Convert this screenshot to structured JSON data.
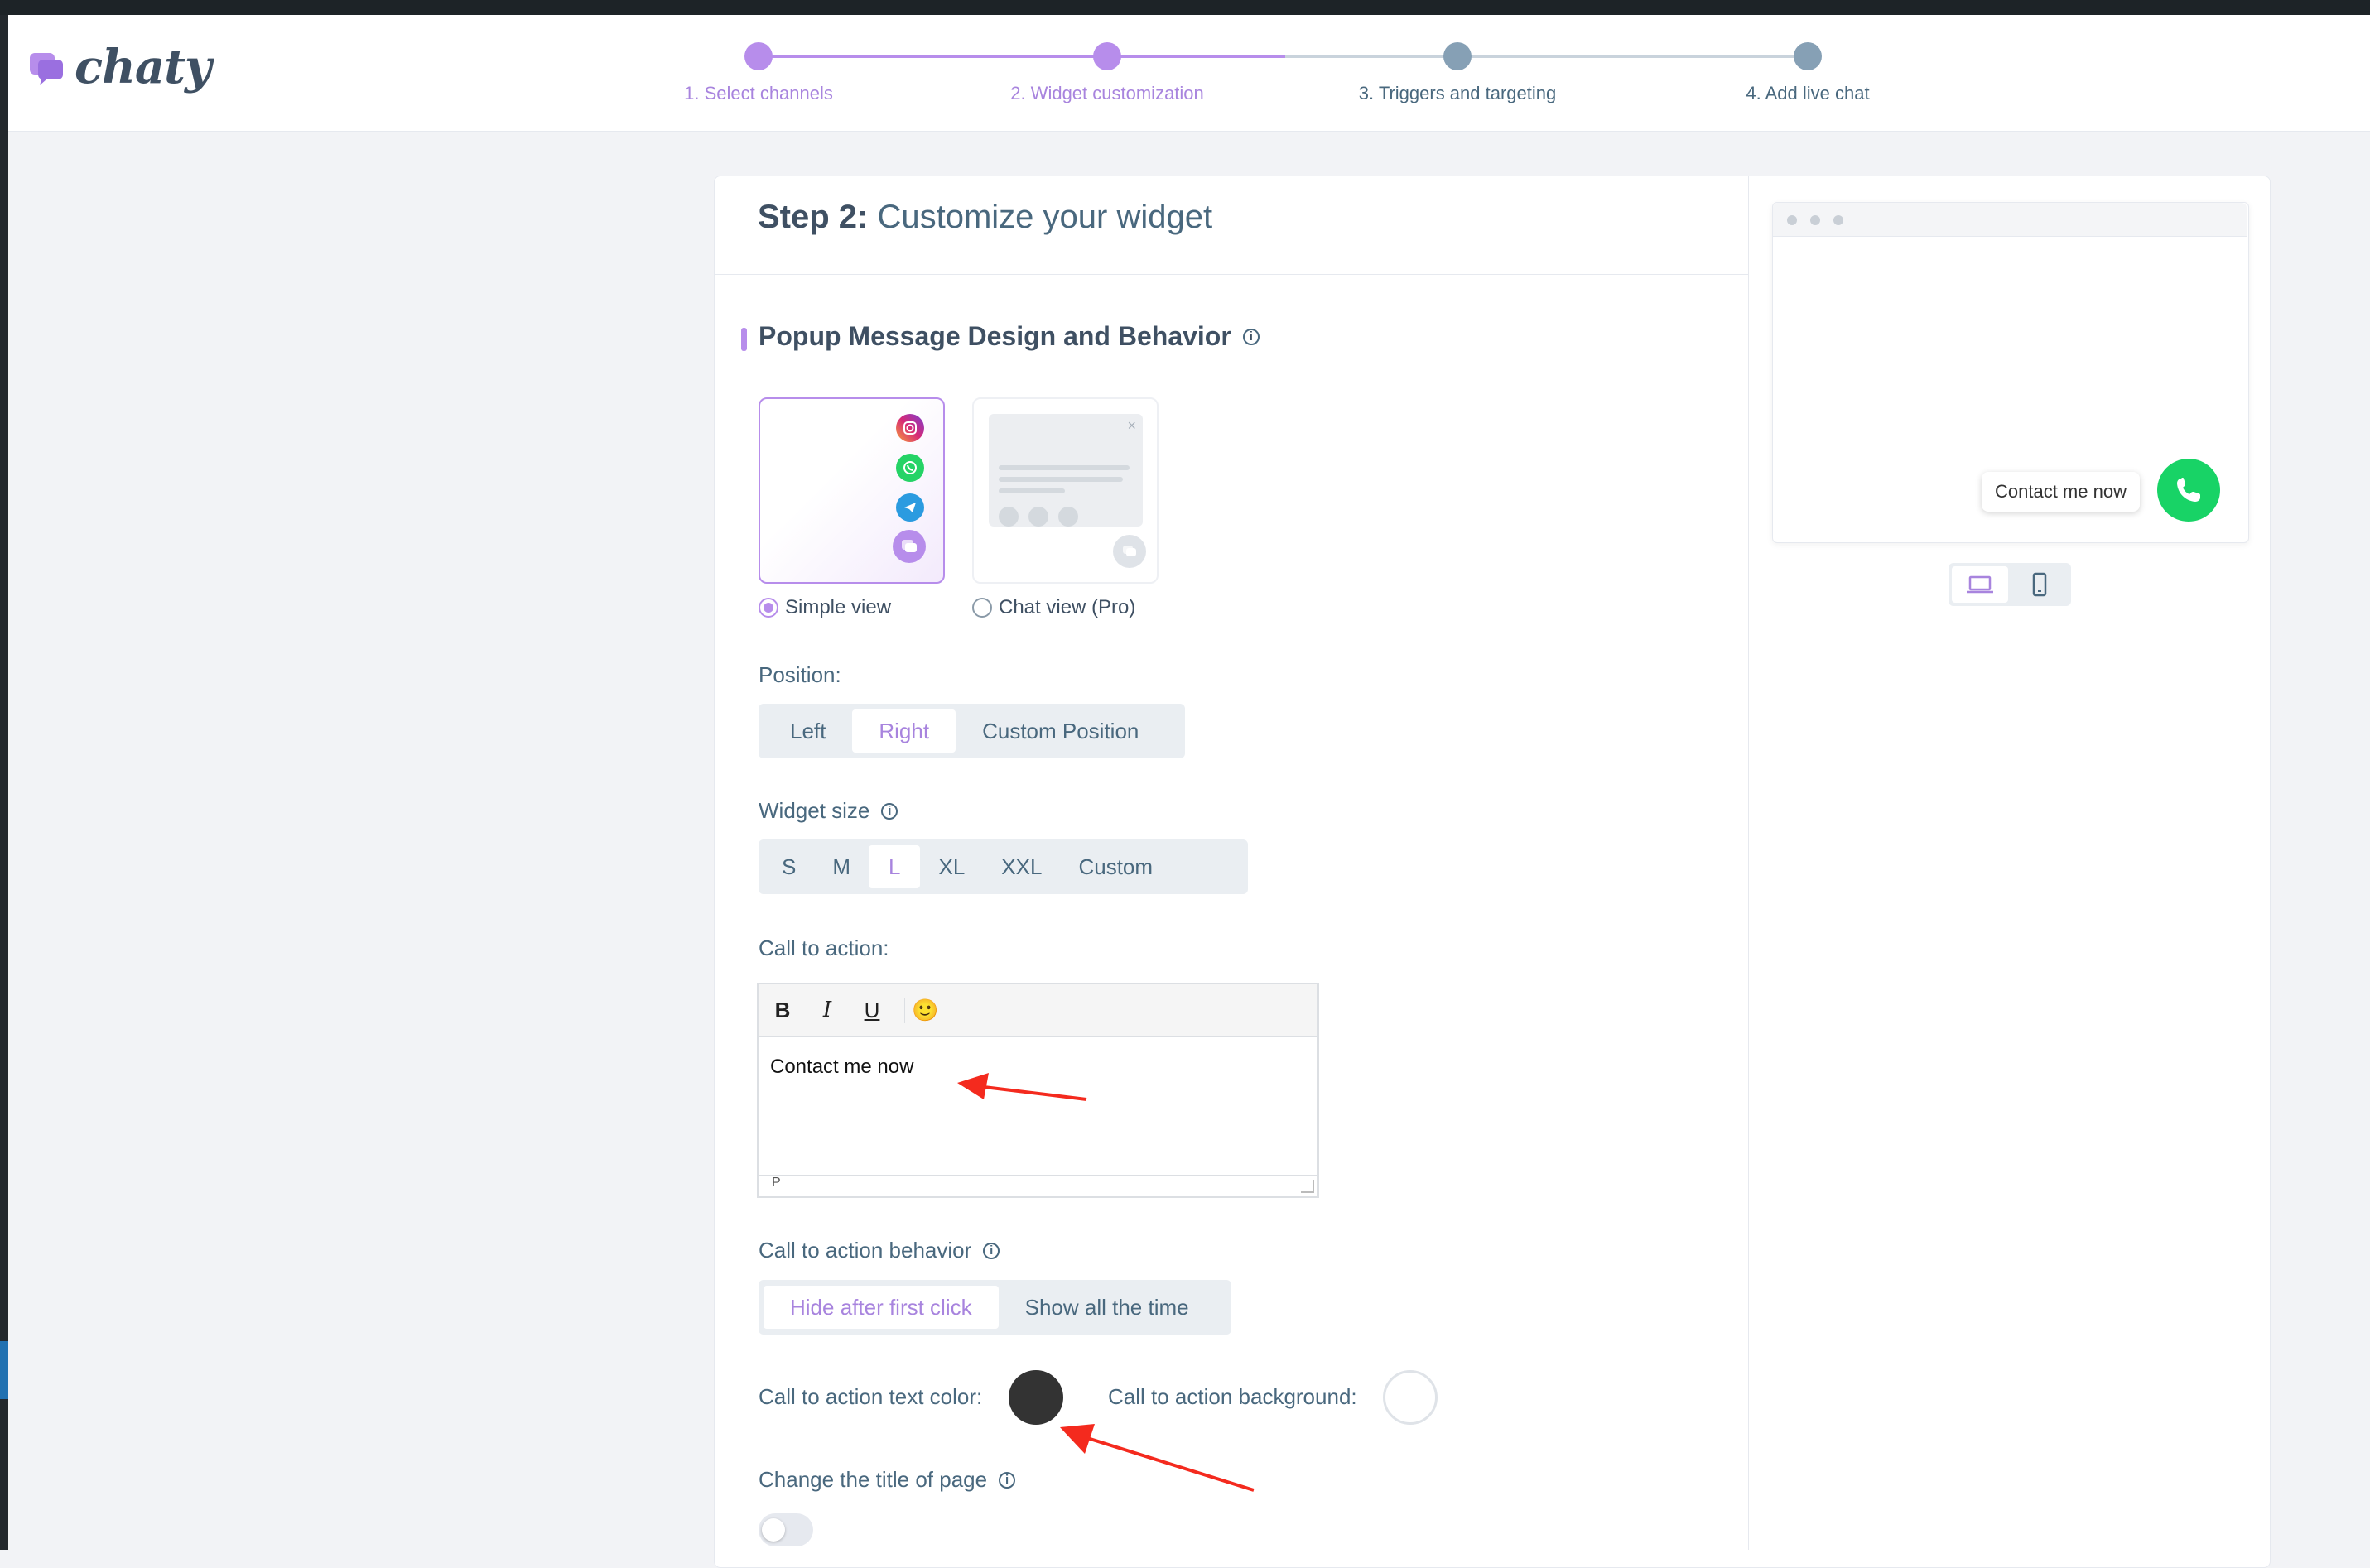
{
  "app": {
    "logo_text": "chaty",
    "brand_color": "#b78deb"
  },
  "stepper": {
    "steps": [
      {
        "label": "1. Select channels",
        "state": "done"
      },
      {
        "label": "2. Widget customization",
        "state": "active"
      },
      {
        "label": "3. Triggers and targeting",
        "state": "pending"
      },
      {
        "label": "4. Add live chat",
        "state": "pending"
      }
    ]
  },
  "page": {
    "title_bold": "Step 2:",
    "title_rest": " Customize your widget"
  },
  "section": {
    "title": "Popup Message Design and Behavior"
  },
  "views": {
    "simple_label": "Simple view",
    "chat_label": "Chat view (Pro)",
    "selected": "simple",
    "simple_icons": [
      "instagram-icon",
      "whatsapp-icon",
      "telegram-icon",
      "chaty-icon"
    ]
  },
  "position": {
    "label": "Position:",
    "options": [
      "Left",
      "Right",
      "Custom Position"
    ],
    "selected": "Right"
  },
  "widget_size": {
    "label": "Widget size",
    "options": [
      "S",
      "M",
      "L",
      "XL",
      "XXL",
      "Custom"
    ],
    "selected": "L"
  },
  "cta": {
    "label": "Call to action:",
    "toolbar": {
      "bold": "B",
      "italic": "I",
      "underline": "U",
      "emoji": "🙂"
    },
    "text": "Contact me now",
    "status_path": "P"
  },
  "cta_behavior": {
    "label": "Call to action behavior",
    "options": [
      "Hide after first click",
      "Show all the time"
    ],
    "selected": "Hide after first click"
  },
  "colors": {
    "text_color_label": "Call to action text color:",
    "text_color": "#333333",
    "background_label": "Call to action background:",
    "background_color": "#ffffff"
  },
  "page_title_toggle": {
    "label": "Change the title of page",
    "enabled": false
  },
  "preview": {
    "cta_text": "Contact me now",
    "button_color": "#18d366",
    "selected_device": "desktop"
  },
  "annotations": {
    "arrow_color": "#f42a1e"
  }
}
